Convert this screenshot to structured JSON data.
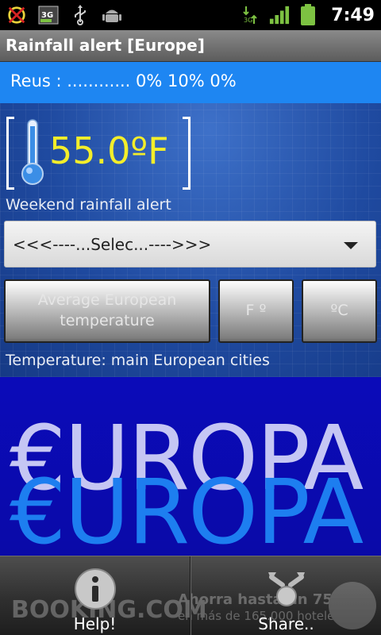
{
  "status_bar": {
    "time": "7:49",
    "icons": [
      "no-signal-warning-icon",
      "3g-notification-icon",
      "usb-icon",
      "android-debug-icon",
      "3g-data-icon",
      "signal-bars-icon",
      "battery-icon"
    ]
  },
  "app": {
    "title": "Rainfall alert [Europe]"
  },
  "rain_strip": {
    "text": "Reus : ............ 0% 10% 0%"
  },
  "thermometer": {
    "value": "55.0ºF"
  },
  "weekend_label": "Weekend rainfall alert",
  "selector": {
    "value": "<<<----...Selec...---->>>"
  },
  "buttons": {
    "average": "Average European temperature",
    "fahrenheit": "F º",
    "celsius": "ºC"
  },
  "temperature_label": "Temperature: main European cities",
  "banner": {
    "line1": "€UROPA",
    "line2": "€UROPA"
  },
  "ad": {
    "brand": "BOOKING.COM",
    "promo1": "Ahorra hasta un 75%",
    "promo2": "en más de 165.000 hoteles"
  },
  "bottom_bar": {
    "help_label": "Help!",
    "share_label": "Share.."
  },
  "colors": {
    "accent_blue": "#1e86f2",
    "temp_yellow": "#f3ee2a",
    "banner_blue": "#0b0bb9",
    "europa_blue": "#1d7ef0"
  }
}
